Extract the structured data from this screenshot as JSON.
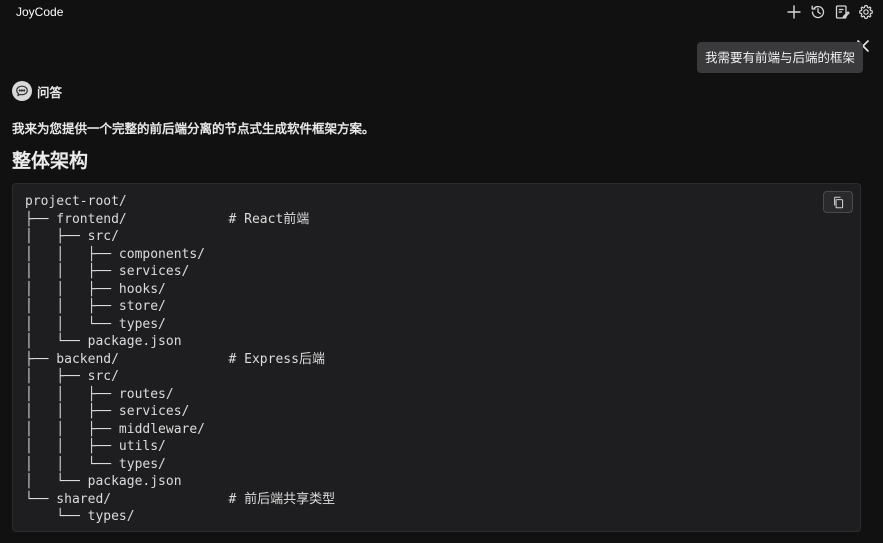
{
  "header": {
    "title": "JoyCode",
    "icons": [
      "plus-icon",
      "history-icon",
      "edit-note-icon",
      "gear-icon"
    ]
  },
  "user_message": {
    "text": "我需要有前端与后端的框架"
  },
  "answer": {
    "label": "问答",
    "intro": "我来为您提供一个完整的前后端分离的节点式生成软件框架方案。",
    "section_title": "整体架构"
  },
  "code": {
    "lines": [
      {
        "tree": "project-root/",
        "comment": ""
      },
      {
        "tree": "├── frontend/             ",
        "comment": "# React前端"
      },
      {
        "tree": "│   ├── src/",
        "comment": ""
      },
      {
        "tree": "│   │   ├── components/",
        "comment": ""
      },
      {
        "tree": "│   │   ├── services/",
        "comment": ""
      },
      {
        "tree": "│   │   ├── hooks/",
        "comment": ""
      },
      {
        "tree": "│   │   ├── store/",
        "comment": ""
      },
      {
        "tree": "│   │   └── types/",
        "comment": ""
      },
      {
        "tree": "│   └── package.json",
        "comment": ""
      },
      {
        "tree": "├── backend/              ",
        "comment": "# Express后端"
      },
      {
        "tree": "│   ├── src/",
        "comment": ""
      },
      {
        "tree": "│   │   ├── routes/",
        "comment": ""
      },
      {
        "tree": "│   │   ├── services/",
        "comment": ""
      },
      {
        "tree": "│   │   ├── middleware/",
        "comment": ""
      },
      {
        "tree": "│   │   ├── utils/",
        "comment": ""
      },
      {
        "tree": "│   │   └── types/",
        "comment": ""
      },
      {
        "tree": "│   └── package.json",
        "comment": ""
      },
      {
        "tree": "└── shared/               ",
        "comment": "# 前后端共享类型"
      },
      {
        "tree": "    └── types/",
        "comment": ""
      }
    ]
  },
  "colors": {
    "background": "#111112",
    "code_background": "#1e1e20",
    "bubble_background": "#3a3a3d"
  }
}
